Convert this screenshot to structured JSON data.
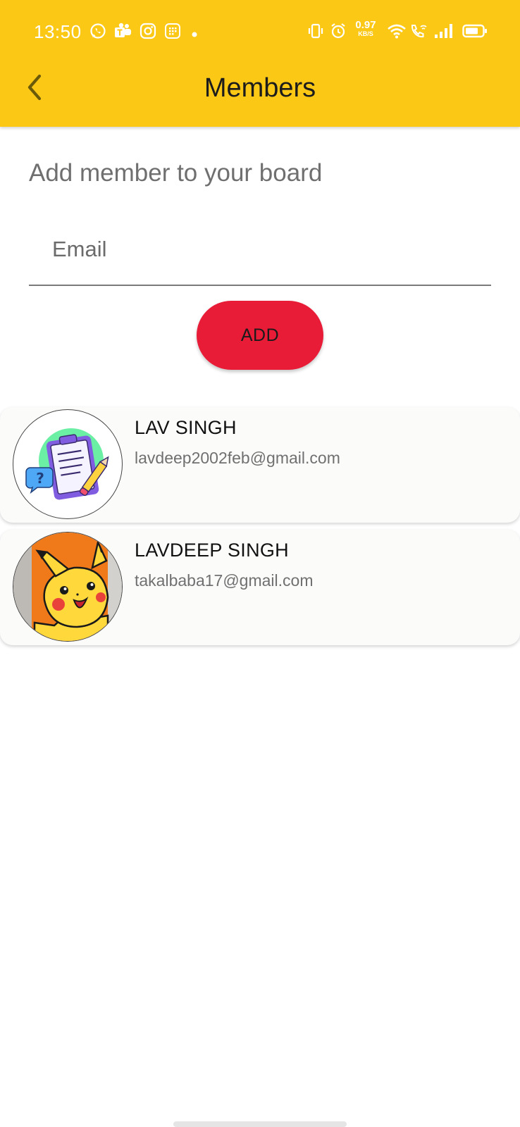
{
  "status_bar": {
    "time": "13:50",
    "net_speed_value": "0.97",
    "net_speed_unit": "KB/S",
    "icons": [
      "whatsapp-icon",
      "teams-icon",
      "instagram-icon",
      "grid-app-icon",
      "notification-dot-icon",
      "vibrate-icon",
      "alarm-icon",
      "wifi-icon",
      "wifi-call-icon",
      "signal-icon",
      "battery-icon"
    ]
  },
  "app_bar": {
    "title": "Members",
    "back_icon": "chevron-left-icon"
  },
  "form": {
    "subtitle": "Add member to your board",
    "email_placeholder": "Email",
    "email_value": "",
    "add_label": "ADD"
  },
  "members": [
    {
      "name": "LAV SINGH",
      "email": "lavdeep2002feb@gmail.com",
      "avatar": "clipboard-illustration-avatar"
    },
    {
      "name": "LAVDEEP SINGH",
      "email": "takalbaba17@gmail.com",
      "avatar": "pikachu-avatar"
    }
  ],
  "colors": {
    "app_bar": "#FBC816",
    "add_button": "#E91C38",
    "card_background": "#FBFCFA",
    "subtitle_text": "#6f6f6f"
  }
}
